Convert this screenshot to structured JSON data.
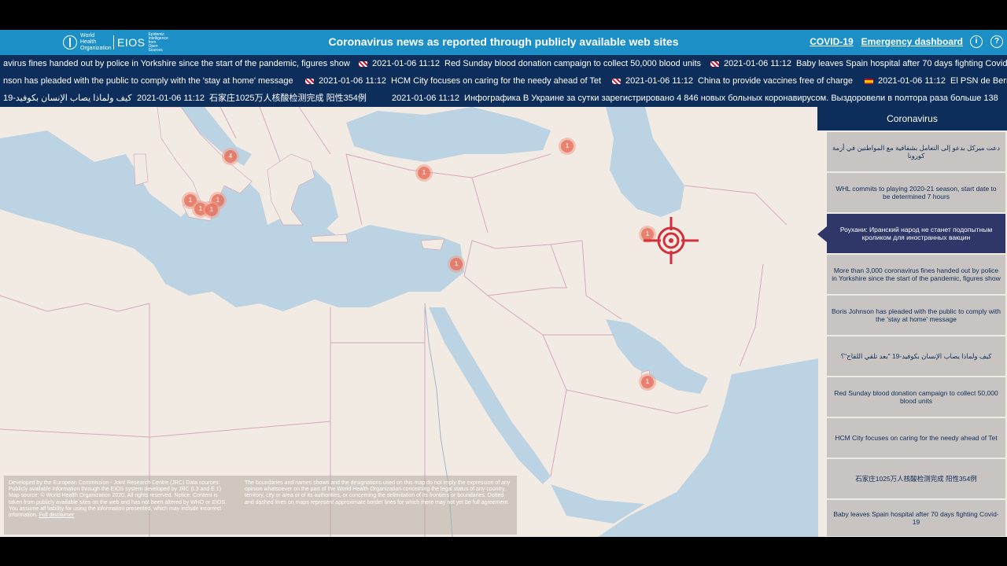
{
  "header": {
    "logo_who": "World Health Organization",
    "logo_eios": "EIOS",
    "logo_eios_sub": "Epidemic Intelligence from Open Sources",
    "title": "Coronavirus news as reported through publicly available web sites",
    "link_covid": "COVID-19",
    "link_dashboard": "Emergency dashboard",
    "info_icon": "info-icon",
    "help_icon": "help-icon",
    "info_glyph": "i",
    "help_glyph": "?"
  },
  "tickers": {
    "line1": [
      {
        "date": "",
        "text": "avirus fines handed out by police in Yorkshire since the start of the pandemic, figures show",
        "flag": ""
      },
      {
        "date": "2021-01-06 11:12",
        "text": "Red Sunday blood donation campaign to collect 50,000 blood units",
        "flag": "uk"
      },
      {
        "date": "2021-01-06 11:12",
        "text": "Baby leaves Spain hospital after 70 days fighting Covid-",
        "flag": "uk"
      }
    ],
    "line2": [
      {
        "date": "",
        "text": "nson has pleaded with the public to comply with the 'stay at home' message",
        "flag": ""
      },
      {
        "date": "2021-01-06 11:12",
        "text": "HCM City focuses on caring for the needy ahead of Tet",
        "flag": "uk"
      },
      {
        "date": "2021-01-06 11:12",
        "text": "China to provide vaccines free of charge",
        "flag": "uk"
      },
      {
        "date": "2021-01-06 11:12",
        "text": "El PSN de Berr",
        "flag": "es"
      }
    ],
    "line3": [
      {
        "date": "",
        "text": "كيف ولماذا يصاب الإنسان بكوفيد-19",
        "flag": ""
      },
      {
        "date": "2021-01-06 11:12",
        "text": "石家庄1025万人核酸检测完成 阳性354例",
        "flag": ""
      },
      {
        "date": "2021-01-06 11:12",
        "text": "Инфографика В Украине за сутки зарегистрировано 4 846 новых больных коронавирусом. Выздоровели в полтора раза больше 138",
        "flag": ""
      }
    ]
  },
  "clusters": [
    {
      "count": "4"
    },
    {
      "count": "1"
    },
    {
      "count": "1"
    },
    {
      "count": "1"
    },
    {
      "count": "1"
    },
    {
      "count": "1"
    },
    {
      "count": "1"
    },
    {
      "count": "1"
    },
    {
      "count": "1"
    },
    {
      "count": "1"
    },
    {
      "count": "1"
    }
  ],
  "disclaimer": {
    "left": "Developed by the European Commission - Joint Research Centre (JRC) Data sources: Publicly available information through the EIOS system developed by JRC (L3 and E.1) Map source: © World Health Organization 2020, All rights reserved. Notice: Content is taken from publicly available sites on the web and has not been altered by WHO or EIOS. You assume all liability for using the information presented, which may include incorrect information.",
    "link": "Full disclaimer",
    "right": "The boundaries and names shown and the designations used on this map do not imply the expression of any opinion whatsoever on the part of the World Health Organization concerning the legal status of any country, territory, city or area or of its authorities, or concerning the delimitation of its frontiers or boundaries. Dotted and dashed lines on maps represent approximate border lines for which there may not yet be full agreement."
  },
  "panel": {
    "title": "Coronavirus",
    "items": [
      {
        "text": "دعت ميركل بدعو إلى التعامل بشفافية مع المواطنين في أزمة كورونا",
        "active": false
      },
      {
        "text": "WHL commits to playing 2020-21 season, start date to be determined 7 hours",
        "active": false
      },
      {
        "text": "Роухани: Иранский народ не станет подопытным кроликом для иностранных вакцин",
        "active": true
      },
      {
        "text": "More than 3,000 coronavirus fines handed out by police in Yorkshire since the start of the pandemic, figures show",
        "active": false
      },
      {
        "text": "Boris Johnson has pleaded with the public to comply with the 'stay at home' message",
        "active": false
      },
      {
        "text": "كيف ولماذا يصاب الإنسان بكوفيد-19 \"بعد تلقي اللقاح\"؟",
        "active": false
      },
      {
        "text": "Red Sunday blood donation campaign to collect 50,000 blood units",
        "active": false
      },
      {
        "text": "HCM City focuses on caring for the needy ahead of Tet",
        "active": false
      },
      {
        "text": "石家庄1025万人核酸检测完成 阳性354例",
        "active": false
      },
      {
        "text": "Baby leaves Spain hospital after 70 days fighting Covid-19",
        "active": false
      }
    ]
  },
  "colors": {
    "header": "#1c8fc7",
    "ticker_bg": "#0d2d5b",
    "land": "#f2ebe3",
    "water": "#bcd3e3",
    "marker": "#e6705a",
    "target": "#d3303c",
    "panel_active": "#2e3768"
  }
}
